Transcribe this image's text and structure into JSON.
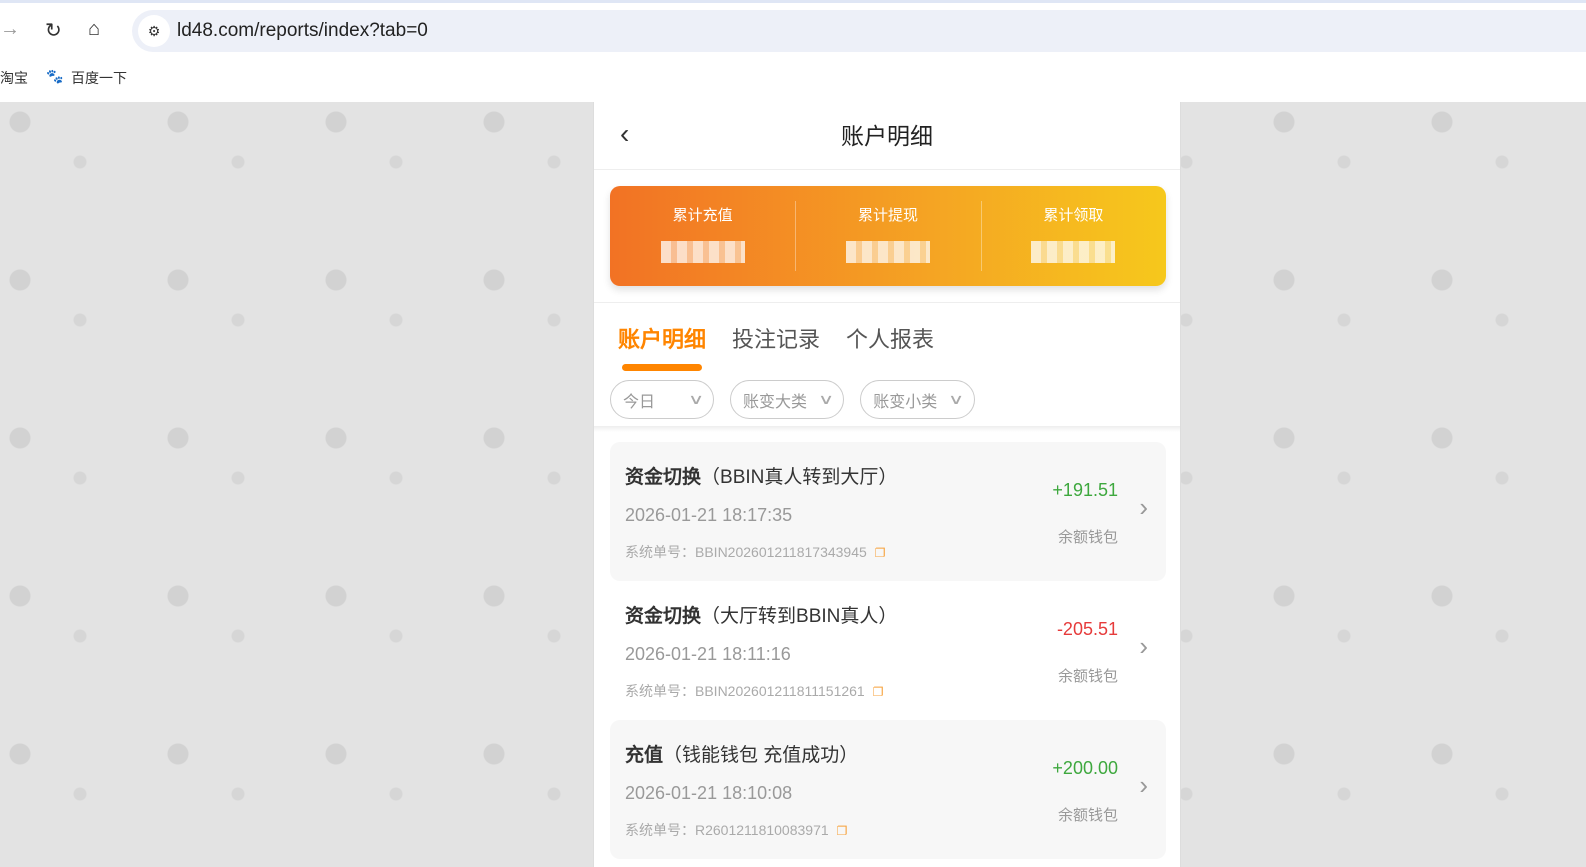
{
  "browser": {
    "url": "ld48.com/reports/index?tab=0",
    "bookmarks": [
      "淘宝",
      "百度一下"
    ]
  },
  "header": {
    "title": "账户明细"
  },
  "summary": [
    {
      "label": "累计充值"
    },
    {
      "label": "累计提现"
    },
    {
      "label": "累计领取"
    }
  ],
  "tabs": [
    "账户明细",
    "投注记录",
    "个人报表"
  ],
  "filters": [
    "今日",
    "账变大类",
    "账变小类"
  ],
  "colors": {
    "accent": "#ff8500",
    "positive": "#3ea83e",
    "negative": "#e63b3b"
  },
  "records": [
    {
      "type": "资金切换",
      "detail": "（BBIN真人转到大厅）",
      "time": "2026-01-21 18:17:35",
      "order": "系统单号：BBIN202601211817343945",
      "amount": "+191.51",
      "wallet": "余额钱包"
    },
    {
      "type": "资金切换",
      "detail": "（大厅转到BBIN真人）",
      "time": "2026-01-21 18:11:16",
      "order": "系统单号：BBIN202601211811151261",
      "amount": "-205.51",
      "wallet": "余额钱包"
    },
    {
      "type": "充值",
      "detail": "（钱能钱包 充值成功）",
      "time": "2026-01-21 18:10:08",
      "order": "系统单号：R2601211810083971",
      "amount": "+200.00",
      "wallet": "余额钱包"
    }
  ]
}
